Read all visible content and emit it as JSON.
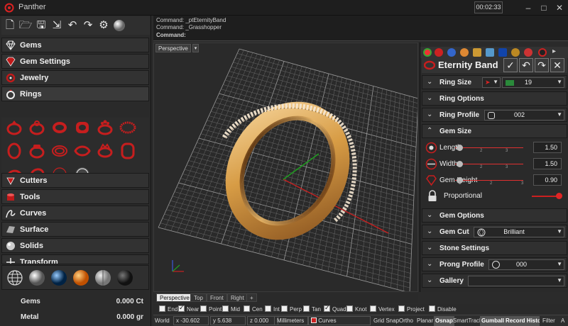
{
  "app": {
    "title": "Panther",
    "timer": "00:02:33"
  },
  "toolbar": {
    "icons": [
      "new-file-icon",
      "open-folder-icon",
      "save-icon",
      "export-icon",
      "undo-icon",
      "redo-icon",
      "settings-icon",
      "render-sphere-icon"
    ]
  },
  "left_menu": {
    "categories_top": [
      {
        "label": "Gems",
        "icon": "diamond-icon"
      },
      {
        "label": "Gem Settings",
        "icon": "gem-setting-icon"
      },
      {
        "label": "Jewelry",
        "icon": "jewelry-icon"
      },
      {
        "label": "Rings",
        "icon": "ring-icon"
      }
    ],
    "categories_bottom": [
      {
        "label": "Cutters",
        "icon": "cutter-icon"
      },
      {
        "label": "Tools",
        "icon": "tools-icon"
      },
      {
        "label": "Curves",
        "icon": "curve-icon"
      },
      {
        "label": "Surface",
        "icon": "surface-icon"
      },
      {
        "label": "Solids",
        "icon": "solids-icon"
      },
      {
        "label": "Transform",
        "icon": "transform-icon"
      }
    ],
    "stats": [
      {
        "label": "Gems",
        "value": "0.000 Ct"
      },
      {
        "label": "Metal",
        "value": "0.000 gr"
      }
    ]
  },
  "command": {
    "lines": [
      "Command: _ptEternityBand",
      "Command: _Grasshopper",
      "Command:"
    ]
  },
  "viewport": {
    "title": "Perspective",
    "tabs": [
      "Perspective",
      "Top",
      "Front",
      "Right"
    ],
    "active_tab": "Perspective",
    "add_tab": "+"
  },
  "osnap": [
    {
      "label": "End",
      "checked": false
    },
    {
      "label": "Near",
      "checked": true
    },
    {
      "label": "Point",
      "checked": false
    },
    {
      "label": "Mid",
      "checked": false
    },
    {
      "label": "Cen",
      "checked": false
    },
    {
      "label": "Int",
      "checked": false
    },
    {
      "label": "Perp",
      "checked": false
    },
    {
      "label": "Tan",
      "checked": false
    },
    {
      "label": "Quad",
      "checked": true
    },
    {
      "label": "Knot",
      "checked": false
    },
    {
      "label": "Vertex",
      "checked": false
    },
    {
      "label": "Project",
      "checked": false
    },
    {
      "label": "Disable",
      "checked": false
    }
  ],
  "status": {
    "cplane": "World",
    "x": "x -30.602",
    "y": "y 5.638",
    "z": "z 0.000",
    "units": "Millimeters",
    "layer": "Curves",
    "layer_color": "#cc2222",
    "buttons": [
      "Grid Snap",
      "Ortho",
      "Planar",
      "Osnap",
      "SmartTrack",
      "Gumball",
      "Record History",
      "Filter",
      "A"
    ],
    "active_buttons": [
      "Osnap",
      "Gumball",
      "Record History"
    ]
  },
  "right_panel": {
    "header_title": "Eternity Band",
    "header_buttons": [
      "✓",
      "↶",
      "↷",
      "✕"
    ],
    "ring_size": {
      "label": "Ring Size",
      "value": "19"
    },
    "ring_options": {
      "label": "Ring Options"
    },
    "ring_profile": {
      "label": "Ring Profile",
      "value": "002"
    },
    "gem_size": {
      "label": "Gem Size",
      "sliders": [
        {
          "label": "Length",
          "value": "1.50",
          "fraction": 0.0
        },
        {
          "label": "Width",
          "value": "1.50",
          "fraction": 0.0
        },
        {
          "label": "Gem Height",
          "value": "0.90",
          "fraction": 0.0
        }
      ],
      "ticks": [
        "1",
        "2",
        "3"
      ],
      "proportional_label": "Proportional",
      "proportional_on": true
    },
    "gem_options": {
      "label": "Gem Options"
    },
    "gem_cut": {
      "label": "Gem Cut",
      "value": "Brilliant"
    },
    "stone_settings": {
      "label": "Stone Settings"
    },
    "prong_profile": {
      "label": "Prong Profile",
      "value": "000"
    },
    "gallery": {
      "label": "Gallery",
      "value": ""
    }
  },
  "colors": {
    "accent_red": "#cc1f1f",
    "gold": "#e0ae5a",
    "background": "#2a2a2a"
  }
}
